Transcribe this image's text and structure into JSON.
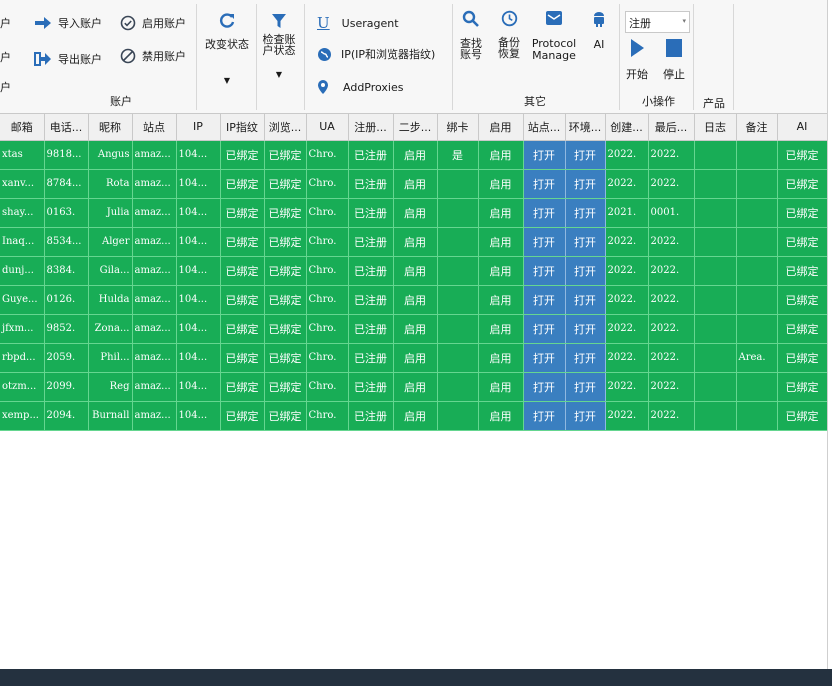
{
  "ribbon": {
    "account_group": {
      "left_labels": [
        "户",
        "户",
        "户"
      ],
      "import_label": "导入账户",
      "export_label": "导出账户",
      "enable_label": "启用账户",
      "disable_label": "禁用账户",
      "group_label": "账户"
    },
    "change_status": {
      "label": "改变状态"
    },
    "check_status": {
      "label_line1": "检查账",
      "label_line2": "户状态"
    },
    "settings": {
      "useragent_label": "Useragent",
      "ip_label": "IP(IP和浏览器指纹)",
      "proxies_label": "AddProxies"
    },
    "other_group": {
      "find_line1": "查找",
      "find_line2": "账号",
      "backup_line1": "备份",
      "backup_line2": "恢复",
      "protocol_line1": "Protocol",
      "protocol_line2": "Manage",
      "ai_label": "AI",
      "group_label": "其它"
    },
    "mini_ops": {
      "select_value": "注册",
      "start_label": "开始",
      "stop_label": "停止",
      "group_label": "小操作"
    },
    "product": {
      "group_label": "产品"
    }
  },
  "table": {
    "headers": [
      "邮箱",
      "电话...",
      "昵称",
      "站点",
      "IP",
      "IP指纹",
      "浏览...",
      "UA",
      "注册...",
      "二步...",
      "绑卡",
      "启用",
      "站点...",
      "环境...",
      "创建...",
      "最后...",
      "日志",
      "备注",
      "AI"
    ],
    "rows": [
      [
        "xtas",
        "9818...",
        "Angus",
        "amaz...",
        "104...",
        "已绑定",
        "已绑定",
        "Chro.",
        "已注册",
        "启用",
        "是",
        "启用",
        "打开",
        "打开",
        "2022.",
        "2022.",
        "",
        "",
        "已绑定"
      ],
      [
        "xanv...",
        "8784...",
        "Rota",
        "amaz...",
        "104...",
        "已绑定",
        "已绑定",
        "Chro.",
        "已注册",
        "启用",
        "",
        "启用",
        "打开",
        "打开",
        "2022.",
        "2022.",
        "",
        "",
        "已绑定"
      ],
      [
        "shay...",
        "0163.",
        "Julia",
        "amaz...",
        "104...",
        "已绑定",
        "已绑定",
        "Chro.",
        "已注册",
        "启用",
        "",
        "启用",
        "打开",
        "打开",
        "2021.",
        "0001.",
        "",
        "",
        "已绑定"
      ],
      [
        "Inaq...",
        "8534...",
        "Alger",
        "amaz...",
        "104...",
        "已绑定",
        "已绑定",
        "Chro.",
        "已注册",
        "启用",
        "",
        "启用",
        "打开",
        "打开",
        "2022.",
        "2022.",
        "",
        "",
        "已绑定"
      ],
      [
        "dunj...",
        "8384.",
        "Gila...",
        "amaz...",
        "104...",
        "已绑定",
        "已绑定",
        "Chro.",
        "已注册",
        "启用",
        "",
        "启用",
        "打开",
        "打开",
        "2022.",
        "2022.",
        "",
        "",
        "已绑定"
      ],
      [
        "Guye...",
        "0126.",
        "Hulda",
        "amaz...",
        "104...",
        "已绑定",
        "已绑定",
        "Chro.",
        "已注册",
        "启用",
        "",
        "启用",
        "打开",
        "打开",
        "2022.",
        "2022.",
        "",
        "",
        "已绑定"
      ],
      [
        "jfxm...",
        "9852.",
        "Zona...",
        "amaz...",
        "104...",
        "已绑定",
        "已绑定",
        "Chro.",
        "已注册",
        "启用",
        "",
        "启用",
        "打开",
        "打开",
        "2022.",
        "2022.",
        "",
        "",
        "已绑定"
      ],
      [
        "rbpd...",
        "2059.",
        "Phil...",
        "amaz...",
        "104...",
        "已绑定",
        "已绑定",
        "Chro.",
        "已注册",
        "启用",
        "",
        "启用",
        "打开",
        "打开",
        "2022.",
        "2022.",
        "",
        "Area.",
        "已绑定"
      ],
      [
        "otzm...",
        "2099.",
        "Reg",
        "amaz...",
        "104...",
        "已绑定",
        "已绑定",
        "Chro.",
        "已注册",
        "启用",
        "",
        "启用",
        "打开",
        "打开",
        "2022.",
        "2022.",
        "",
        "",
        "已绑定"
      ],
      [
        "xemp...",
        "2094.",
        "Burnall",
        "amaz...",
        "104...",
        "已绑定",
        "已绑定",
        "Chro.",
        "已注册",
        "启用",
        "",
        "启用",
        "打开",
        "打开",
        "2022.",
        "2022.",
        "",
        "",
        "已绑定"
      ]
    ]
  },
  "colors": {
    "row_green": "#18ad56",
    "open_blue": "#3a7fc0",
    "footer": "#24313f",
    "icon_blue": "#2a6db8"
  }
}
